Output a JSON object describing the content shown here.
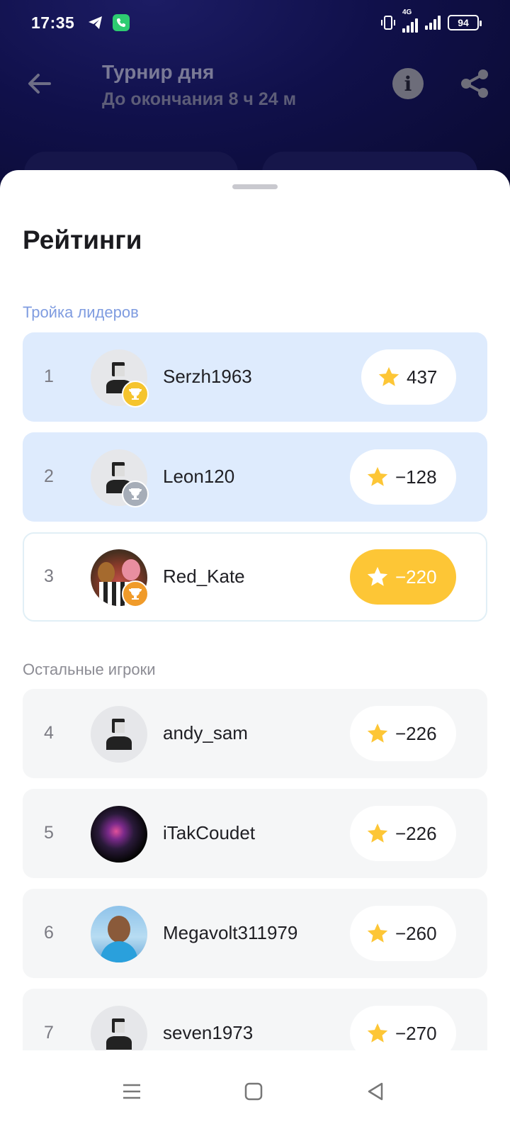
{
  "status_bar": {
    "time": "17:35",
    "icons": [
      "telegram-icon",
      "phone-call-icon",
      "vibrate-icon",
      "4g-signal-icon",
      "signal-icon",
      "battery-icon"
    ],
    "network": "4G",
    "battery": "94"
  },
  "header": {
    "title": "Турнир дня",
    "subtitle": "До окончания 8 ч 24 м",
    "icons": [
      "back-arrow-icon",
      "info-icon",
      "share-icon"
    ]
  },
  "sheet": {
    "title": "Рейтинги",
    "leaders_label": "Тройка лидеров",
    "others_label": "Остальные игроки"
  },
  "leaders": [
    {
      "rank": "1",
      "name": "Serzh1963",
      "score": "437",
      "trophy": "gold",
      "avatar": "default"
    },
    {
      "rank": "2",
      "name": "Leon120",
      "score": "−128",
      "trophy": "silver",
      "avatar": "default"
    },
    {
      "rank": "3",
      "name": "Red_Kate",
      "score": "−220",
      "trophy": "bronze",
      "avatar": "photo-mascots",
      "highlighted": true
    }
  ],
  "others": [
    {
      "rank": "4",
      "name": "andy_sam",
      "score": "−226",
      "avatar": "default"
    },
    {
      "rank": "5",
      "name": "iTakCoudet",
      "score": "−226",
      "avatar": "photo-night"
    },
    {
      "rank": "6",
      "name": "Megavolt311979",
      "score": "−260",
      "avatar": "photo-man"
    },
    {
      "rank": "7",
      "name": "seven1973",
      "score": "−270",
      "avatar": "default"
    }
  ],
  "colors": {
    "accent_star": "#fdc636",
    "leader_row_bg": "#deebfd",
    "other_row_bg": "#f5f6f7",
    "leaders_label": "#7f9ce0"
  },
  "navbar": {
    "icons": [
      "menu-icon",
      "home-square-icon",
      "back-triangle-icon"
    ]
  }
}
